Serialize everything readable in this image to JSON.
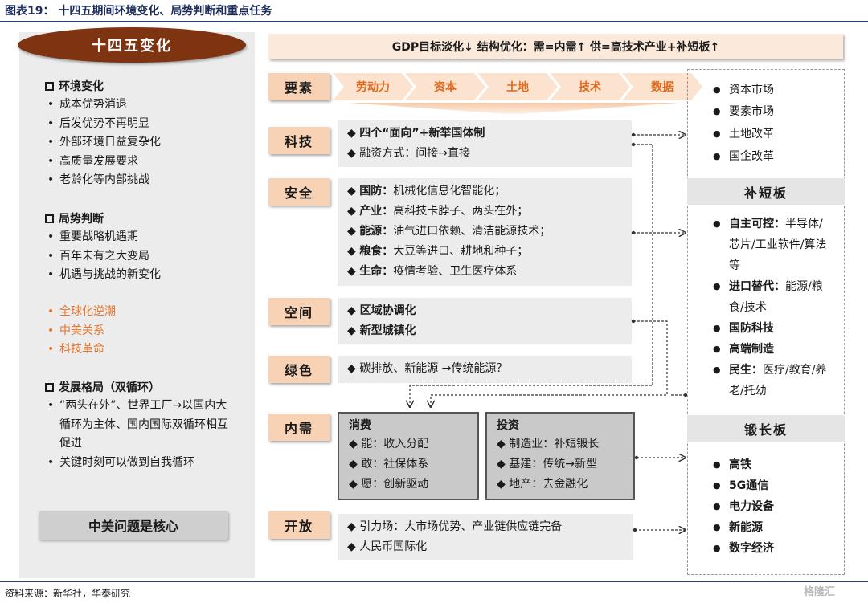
{
  "title": "图表19：  十四五期间环境变化、局势判断和重点任务",
  "left": {
    "header": "十四五变化",
    "sections": [
      {
        "heading": "环境变化",
        "items": [
          "成本优势消退",
          "后发优势不再明显",
          "外部环境日益复杂化",
          "高质量发展要求",
          "老龄化等内部挑战"
        ]
      },
      {
        "heading": "局势判断",
        "items": [
          "重要战略机遇期",
          "百年未有之大变局",
          "机遇与挑战的新变化"
        ]
      }
    ],
    "highlights": [
      "全球化逆潮",
      "中美关系",
      "科技革命"
    ],
    "dev": {
      "heading": "发展格局（双循环）",
      "items": [
        "“两头在外”、世界工厂→以国内大循环为主体、国内国际双循环相互促进",
        "关键时刻可以做到自我循环"
      ]
    },
    "footer": "中美问题是核心"
  },
  "banner": "GDP目标淡化↓    结构优化：需=内需↑  供=高技术产业+补短板↑",
  "categories": {
    "factors": "要素",
    "tech": "科技",
    "security": "安全",
    "space": "空间",
    "green": "绿色",
    "demand": "内需",
    "open": "开放"
  },
  "factors_chain": [
    "劳动力",
    "资本",
    "土地",
    "技术",
    "数据"
  ],
  "tech_box": [
    {
      "b": "四个“面向”+新举国体制",
      "t": ""
    },
    {
      "b": "",
      "t": "融资方式：间接→直接"
    }
  ],
  "security_box": [
    {
      "b": "国防：",
      "t": "机械化信息化智能化；"
    },
    {
      "b": "产业：",
      "t": "高科技卡脖子、两头在外；"
    },
    {
      "b": "能源：",
      "t": "油气进口依赖、清洁能源技术；"
    },
    {
      "b": "粮食：",
      "t": "大豆等进口、耕地和种子；"
    },
    {
      "b": "生命：",
      "t": "疫情考验、卫生医疗体系"
    }
  ],
  "space_box": [
    "区域协调化",
    "新型城镇化"
  ],
  "green_box": "碳排放、新能源 →传统能源？",
  "consumption": {
    "heading": "消费",
    "items": [
      "能：收入分配",
      "敢：社保体系",
      "愿：创新驱动"
    ]
  },
  "investment": {
    "heading": "投资",
    "items": [
      "制造业：补短锻长",
      "基建：传统→新型",
      "地产：去金融化"
    ]
  },
  "open_box": [
    "引力场：大市场优势、产业链供应链完备",
    "人民币国际化"
  ],
  "right": {
    "reform": [
      "资本市场",
      "要素市场",
      "土地改革",
      "国企改革"
    ],
    "shortboard_head": "补短板",
    "shortboard": [
      {
        "b": "自主可控：",
        "t": "半导体/芯片/工业软件/算法等"
      },
      {
        "b": "进口替代：",
        "t": "能源/粮食/技术"
      },
      {
        "b": "国防科技",
        "t": ""
      },
      {
        "b": "高端制造",
        "t": ""
      },
      {
        "b": "民生：",
        "t": "医疗/教育/养老/托幼"
      }
    ],
    "longboard_head": "锻长板",
    "longboard": [
      "高铁",
      "5G通信",
      "电力设备",
      "新能源",
      "数字经济"
    ]
  },
  "source": "资料来源：新华社，华泰研究",
  "watermark": "格隆汇",
  "colors": {
    "oval": "#7e3311",
    "category": "#f7d2b4",
    "chevron_text": "#e06a1c",
    "highlight": "#e3762e",
    "title": "#1b2b5a"
  }
}
